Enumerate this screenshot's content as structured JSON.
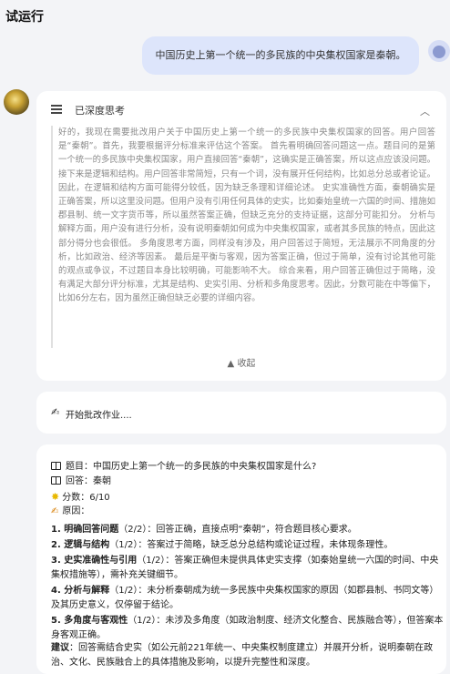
{
  "header": {
    "title": "试运行"
  },
  "user_message": "中国历史上第一个统一的多民族的中央集权国家是秦朝。",
  "thinking": {
    "label": "已深度思考",
    "text": "好的，我现在需要批改用户关于中国历史上第一个统一的多民族中央集权国家的回答。用户回答是“秦朝”。首先，我要根据评分标准来评估这个答案。 首先看明确回答问题这一点。题目问的是第一个统一的多民族中央集权国家，用户直接回答“秦朝”，这确实是正确答案，所以这点应该没问题。 接下来是逻辑和结构。用户回答非常简短，只有一个词，没有展开任何结构，比如总分总或者论证。因此，在逻辑和结构方面可能得分较低，因为缺乏条理和详细论述。 史实准确性方面，秦朝确实是正确答案，所以这里没问题。但用户没有引用任何具体的史实，比如秦始皇统一六国的时间、措施如郡县制、统一文字货币等，所以虽然答案正确，但缺乏充分的支持证据，这部分可能扣分。 分析与解释方面，用户没有进行分析，没有说明秦朝如何成为中央集权国家，或者其多民族的特点，因此这部分得分也会很低。 多角度思考方面，同样没有涉及，用户回答过于简短，无法展示不同角度的分析，比如政治、经济等因素。 最后是平衡与客观，因为答案正确，但过于简单，没有讨论其他可能的观点或争议，不过题目本身比较明确，可能影响不大。 综合来看，用户回答正确但过于简略，没有满足大部分评分标准，尤其是结构、史实引用、分析和多角度思考。因此，分数可能在中等偏下，比如6分左右，因为虽然正确但缺乏必要的详细内容。",
    "collapse_label": "收起"
  },
  "action": {
    "label": "开始批改作业...."
  },
  "result": {
    "question_label": "题目：中国历史上第一个统一的多民族的中央集权国家是什么?",
    "answer_label": "回答：秦朝",
    "score_label": "分数：6/10",
    "reason_label": "原因：",
    "items": [
      {
        "title": "1. 明确回答问题",
        "score": "（2/2）",
        "detail": "：回答正确，直接点明“秦朝”，符合题目核心要求。"
      },
      {
        "title": "2. 逻辑与结构",
        "score": "（1/2）",
        "detail": "：答案过于简略，缺乏总分总结构或论证过程，未体现条理性。"
      },
      {
        "title": "3. 史实准确性与引用",
        "score": "（1/2）",
        "detail": "：答案正确但未提供具体史实支撑（如秦始皇统一六国的时间、中央集权措施等），需补充关键细节。"
      },
      {
        "title": "4. 分析与解释",
        "score": "（1/2）",
        "detail": "：未分析秦朝成为统一多民族中央集权国家的原因（如郡县制、书同文等）及其历史意义，仅停留于结论。"
      },
      {
        "title": "5. 多角度与客观性",
        "score": "（1/2）",
        "detail": "：未涉及多角度（如政治制度、经济文化整合、民族融合等），但答案本身客观正确。"
      }
    ],
    "suggestion_title": "建议",
    "suggestion_text": "：回答需结合史实（如公元前221年统一、中央集权制度建立）并展开分析，说明秦朝在政治、文化、民族融合上的具体措施及影响，以提升完整性和深度。"
  }
}
